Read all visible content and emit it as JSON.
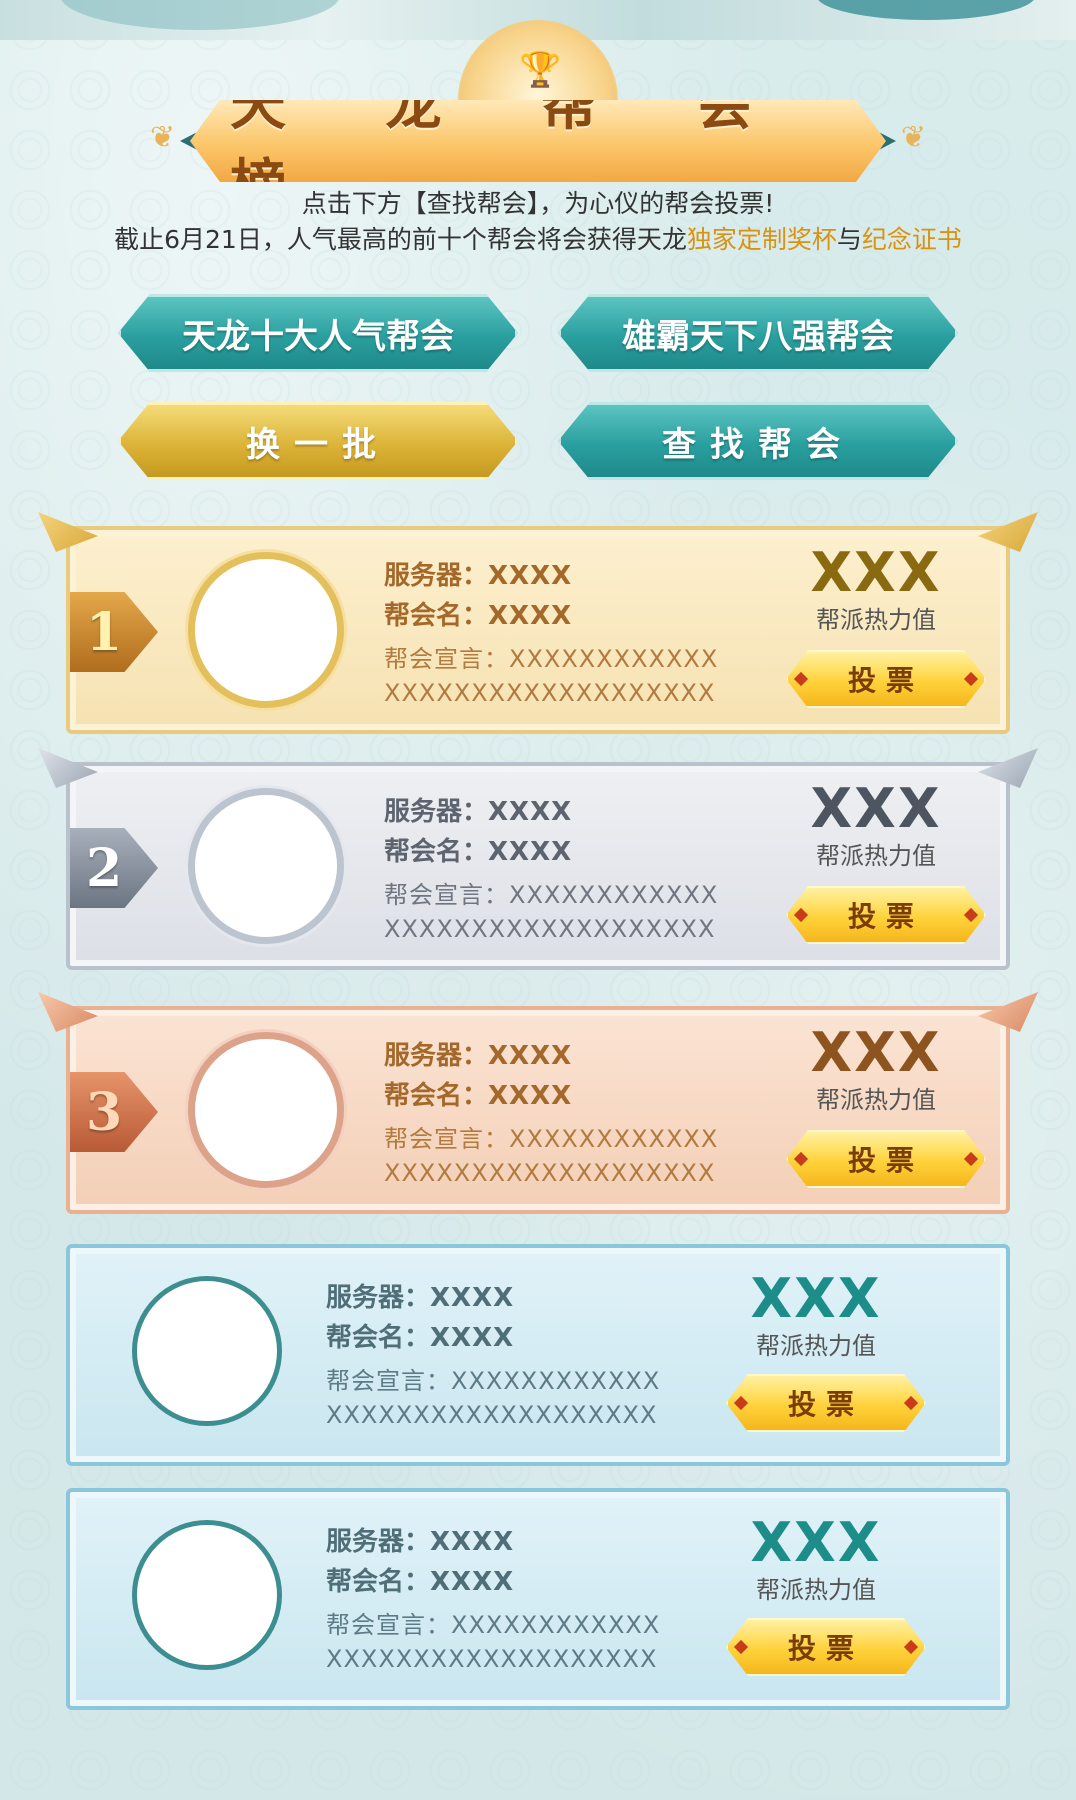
{
  "header": {
    "title": "天 龙 帮 会 榜",
    "trophy_glyph": "🏆"
  },
  "intro": {
    "line1": "点击下方【查找帮会】，为心仪的帮会投票!",
    "line2_prefix": "截止6月21日，人气最高的前十个帮会将会获得天龙",
    "line2_highlight1": "独家定制奖杯",
    "line2_mid": "与",
    "line2_highlight2": "纪念证书",
    "highlight_color": "#d99311"
  },
  "actions": {
    "top10_label": "天龙十大人气帮会",
    "top8_label": "雄霸天下八强帮会",
    "refresh_label": "换一批",
    "find_label": "查找帮会"
  },
  "common": {
    "server_key": "服务器：",
    "name_key": "帮会名：",
    "decl_key": "帮会宣言：",
    "heat_label": "帮派热力值",
    "vote_label": "投票"
  },
  "guilds": [
    {
      "rank": "1",
      "server": "XXXX",
      "name": "XXXX",
      "decl_1": "XXXXXXXXXXXX",
      "decl_2": "XXXXXXXXXXXXXXXXXXX",
      "heat": "XXX"
    },
    {
      "rank": "2",
      "server": "XXXX",
      "name": "XXXX",
      "decl_1": "XXXXXXXXXXXX",
      "decl_2": "XXXXXXXXXXXXXXXXXXX",
      "heat": "XXX"
    },
    {
      "rank": "3",
      "server": "XXXX",
      "name": "XXXX",
      "decl_1": "XXXXXXXXXXXX",
      "decl_2": "XXXXXXXXXXXXXXXXXXX",
      "heat": "XXX"
    },
    {
      "rank": "",
      "server": "XXXX",
      "name": "XXXX",
      "decl_1": "XXXXXXXXXXXX",
      "decl_2": "XXXXXXXXXXXXXXXXXXX",
      "heat": "XXX"
    },
    {
      "rank": "",
      "server": "XXXX",
      "name": "XXXX",
      "decl_1": "XXXXXXXXXXXX",
      "decl_2": "XXXXXXXXXXXXXXXXXXX",
      "heat": "XXX"
    }
  ]
}
